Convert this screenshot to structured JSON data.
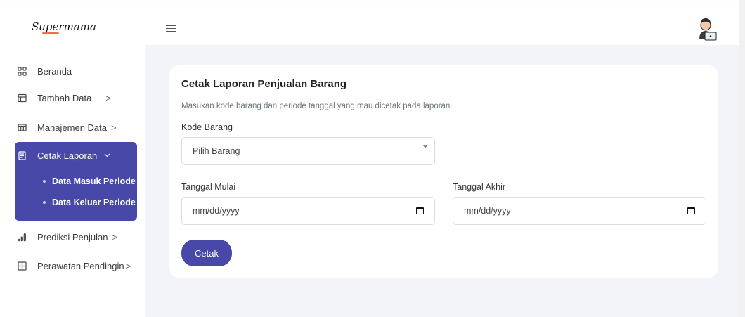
{
  "brand": {
    "name": "Supermama"
  },
  "sidebar": {
    "items": [
      {
        "label": "Beranda",
        "icon": "grid-icon",
        "chevron": ""
      },
      {
        "label": "Tambah Data",
        "icon": "table-icon",
        "chevron": ">"
      },
      {
        "label": "Manajemen Data",
        "icon": "columns-icon",
        "chevron": ">"
      },
      {
        "label": "Cetak Laporan",
        "icon": "document-icon",
        "chevron": "⌄"
      },
      {
        "label": "Prediksi Penjulan",
        "icon": "bar-chart-icon",
        "chevron": ">"
      },
      {
        "label": "Perawatan Pendingin",
        "icon": "plus-grid-icon",
        "chevron": ">"
      }
    ],
    "submenu": [
      {
        "label": "Data Masuk Periode"
      },
      {
        "label": "Data Keluar Periode"
      }
    ]
  },
  "form": {
    "title": "Cetak Laporan Penjualan Barang",
    "subtitle": "Masukan kode barang dan periode tanggal yang mau dicetak pada laporan.",
    "kode_label": "Kode Barang",
    "kode_value": "Pilih Barang",
    "mulai_label": "Tanggal Mulai",
    "mulai_value": "mm/dd/yyyy",
    "akhir_label": "Tanggal Akhir",
    "akhir_value": "mm/dd/yyyy",
    "submit_label": "Cetak"
  },
  "colors": {
    "accent": "#4848a8",
    "background": "#f3f4f9",
    "logo_accent": "#e8734d"
  }
}
